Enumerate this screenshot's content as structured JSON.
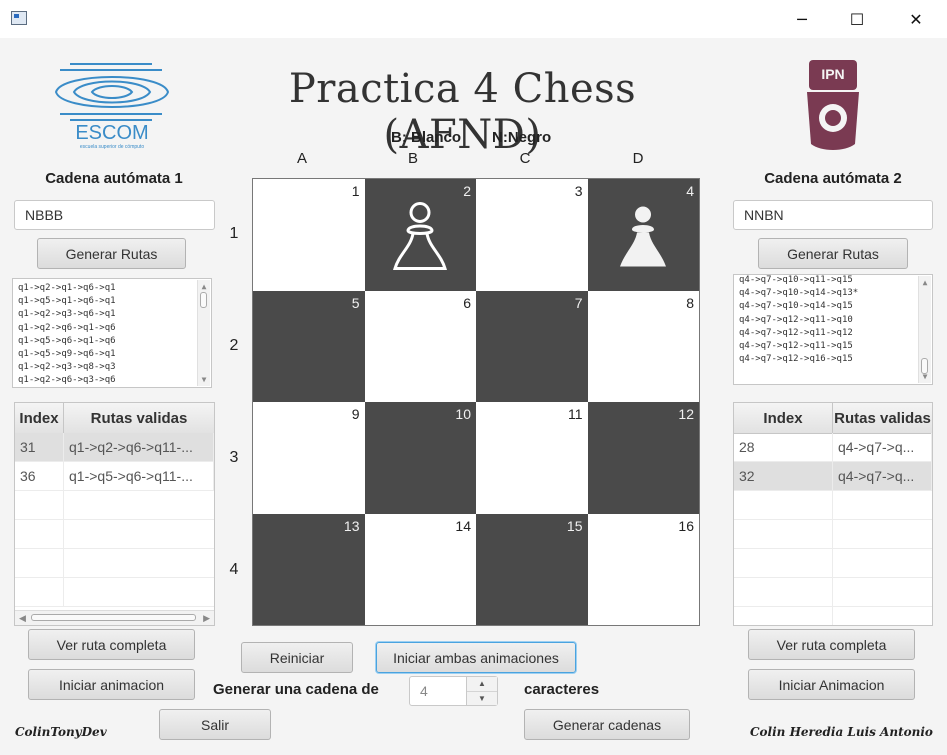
{
  "window": {
    "minimize_icon": "─",
    "maximize_icon": "☐",
    "close_icon": "✕"
  },
  "header": {
    "title": "Practica 4 Chess (AFND)",
    "legend_white": "B: Blanco",
    "legend_black": "N:Negro",
    "left_logo_text": "ESCOM",
    "left_logo_subtext": "escuela superior de cómputo",
    "right_logo_text": "IPN"
  },
  "board": {
    "columns": [
      "A",
      "B",
      "C",
      "D"
    ],
    "rows": [
      "1",
      "2",
      "3",
      "4"
    ],
    "cells": [
      {
        "num": "1",
        "color": "light",
        "piece": ""
      },
      {
        "num": "2",
        "color": "dark",
        "piece": "white-pawn-outline"
      },
      {
        "num": "3",
        "color": "light",
        "piece": ""
      },
      {
        "num": "4",
        "color": "dark",
        "piece": "white-pawn-solid"
      },
      {
        "num": "5",
        "color": "dark",
        "piece": ""
      },
      {
        "num": "6",
        "color": "light",
        "piece": ""
      },
      {
        "num": "7",
        "color": "dark",
        "piece": ""
      },
      {
        "num": "8",
        "color": "light",
        "piece": ""
      },
      {
        "num": "9",
        "color": "light",
        "piece": ""
      },
      {
        "num": "10",
        "color": "dark",
        "piece": ""
      },
      {
        "num": "11",
        "color": "light",
        "piece": ""
      },
      {
        "num": "12",
        "color": "dark",
        "piece": ""
      },
      {
        "num": "13",
        "color": "dark",
        "piece": ""
      },
      {
        "num": "14",
        "color": "light",
        "piece": ""
      },
      {
        "num": "15",
        "color": "dark",
        "piece": ""
      },
      {
        "num": "16",
        "color": "light",
        "piece": ""
      }
    ]
  },
  "left": {
    "label": "Cadena autómata 1",
    "input_value": "NBBB",
    "generate_routes": "Generar Rutas",
    "routes": [
      "q1->q2->q1->q6->q1",
      "q1->q5->q1->q6->q1",
      "q1->q2->q3->q6->q1",
      "q1->q2->q6->q1->q6",
      "q1->q5->q6->q1->q6",
      "q1->q5->q9->q6->q1",
      "q1->q2->q3->q8->q3",
      "q1->q2->q6->q3->q6"
    ],
    "table": {
      "headers": [
        "Index",
        "Rutas validas"
      ],
      "rows": [
        [
          "31",
          "q1->q2->q6->q11-..."
        ],
        [
          "36",
          "q1->q5->q6->q11-..."
        ]
      ]
    },
    "view_full_route": "Ver ruta completa",
    "start_animation": "Iniciar animacion"
  },
  "right": {
    "label": "Cadena autómata 2",
    "input_value": "NNBN",
    "generate_routes": "Generar Rutas",
    "routes": [
      "q4->q7->q10->q11->q15",
      "q4->q7->q10->q14->q13*",
      "q4->q7->q10->q14->q15",
      "q4->q7->q12->q11->q10",
      "q4->q7->q12->q11->q12",
      "q4->q7->q12->q11->q15",
      "q4->q7->q12->q16->q15"
    ],
    "table": {
      "headers": [
        "Index",
        "Rutas validas"
      ],
      "rows": [
        [
          "28",
          "q4->q7->q..."
        ],
        [
          "32",
          "q4->q7->q..."
        ]
      ]
    },
    "view_full_route": "Ver ruta completa",
    "start_animation": "Iniciar Animacion"
  },
  "center": {
    "restart": "Reiniciar",
    "start_both": "Iniciar ambas animaciones",
    "generate_label": "Generar una cadena de",
    "spinner_value": "4",
    "characters_label": "caracteres",
    "exit": "Salir",
    "generate_strings": "Generar cadenas"
  },
  "footer": {
    "left_signature": "ColinTonyDev",
    "right_signature": "Colin Heredia Luis Antonio"
  }
}
